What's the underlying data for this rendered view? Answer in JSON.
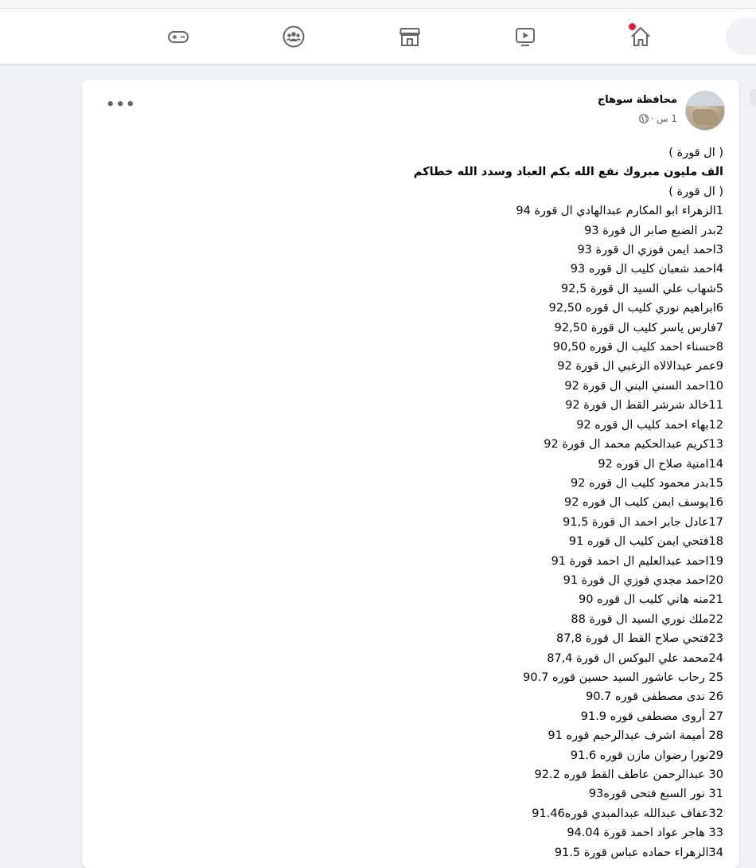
{
  "nav": {
    "items": [
      {
        "name": "gaming",
        "icon": "gamepad-icon"
      },
      {
        "name": "groups",
        "icon": "groups-icon"
      },
      {
        "name": "marketplace",
        "icon": "marketplace-icon"
      },
      {
        "name": "watch",
        "icon": "video-icon"
      },
      {
        "name": "home",
        "icon": "home-icon",
        "has_notification": true
      }
    ],
    "notification_color": "#e41e3f"
  },
  "post": {
    "author": "محافظة سوهاج",
    "time": "1 س",
    "separator": "·",
    "privacy_icon": "globe-icon",
    "more_label": "•••",
    "header_line1": "( ال قورة )",
    "header_line2": "الف مليون مبروك نفع الله بكم العباد وسدد الله خطاكم",
    "header_line3": "( ال قورة )",
    "lines": [
      "1الزهراء ابو المكارم عبدالهادي ال قورة 94",
      "2بدر الضبع صابر ال قورة 93",
      "3احمد ايمن فوزي ال قورة 93",
      "4احمد شعبان كليب ال قوره 93",
      "5شهاب علي السيد ال قورة 92,5",
      "6ابراهيم نوري كليب ال قوره 92,50",
      "7فارس ياسر كليب ال قورة 92,50",
      "8حسناء احمد كليب ال قوره 90,50",
      "9عمر عبدالالاه الزغبي ال قورة 92",
      "10احمد السني البني ال قورة 92",
      "11خالد شرشر القط ال قورة 92",
      "12بهاء احمد كليب ال قوره 92",
      "13كريم عبدالحكيم محمد ال قورة 92",
      "14امنية صلاح ال قوره 92",
      "15بدر محمود كليب ال قوره 92",
      "16يوسف ايمن كليب ال قوره 92",
      "17عادل جابر احمد ال قورة 91,5",
      "18فتحي ايمن كليب ال قوره 91",
      "19احمد عبدالعليم ال احمد قورة 91",
      "20احمد مجدي فوزي ال قورة 91",
      "21منه هاني كليب ال قوره 90",
      "22ملك نوري السيد ال قورة 88",
      "23فتحي صلاح القط ال قورة 87,8",
      "24محمد علي البوكس ال قورة 87,4",
      "25 رحاب عاشور السيد حسين قوره 90.7",
      "26 ندى مصطفى قوره 90.7",
      "27 أروى مصطفى قوره 91.9",
      "28 أميمة اشرف عبدالرحيم قوره 91",
      "29نورا رضوان مازن قوره 91.6",
      "30 عبدالرحمن عاطف القط قوره 92.2",
      "31 نور السبع فتحى قوره93",
      "32عفاف عبدالله عبدالمبدي قوره91.46",
      "33 هاجر عواد احمد قورة 94.04",
      "34الزهراء حماده عباس قورة 91.5"
    ]
  }
}
